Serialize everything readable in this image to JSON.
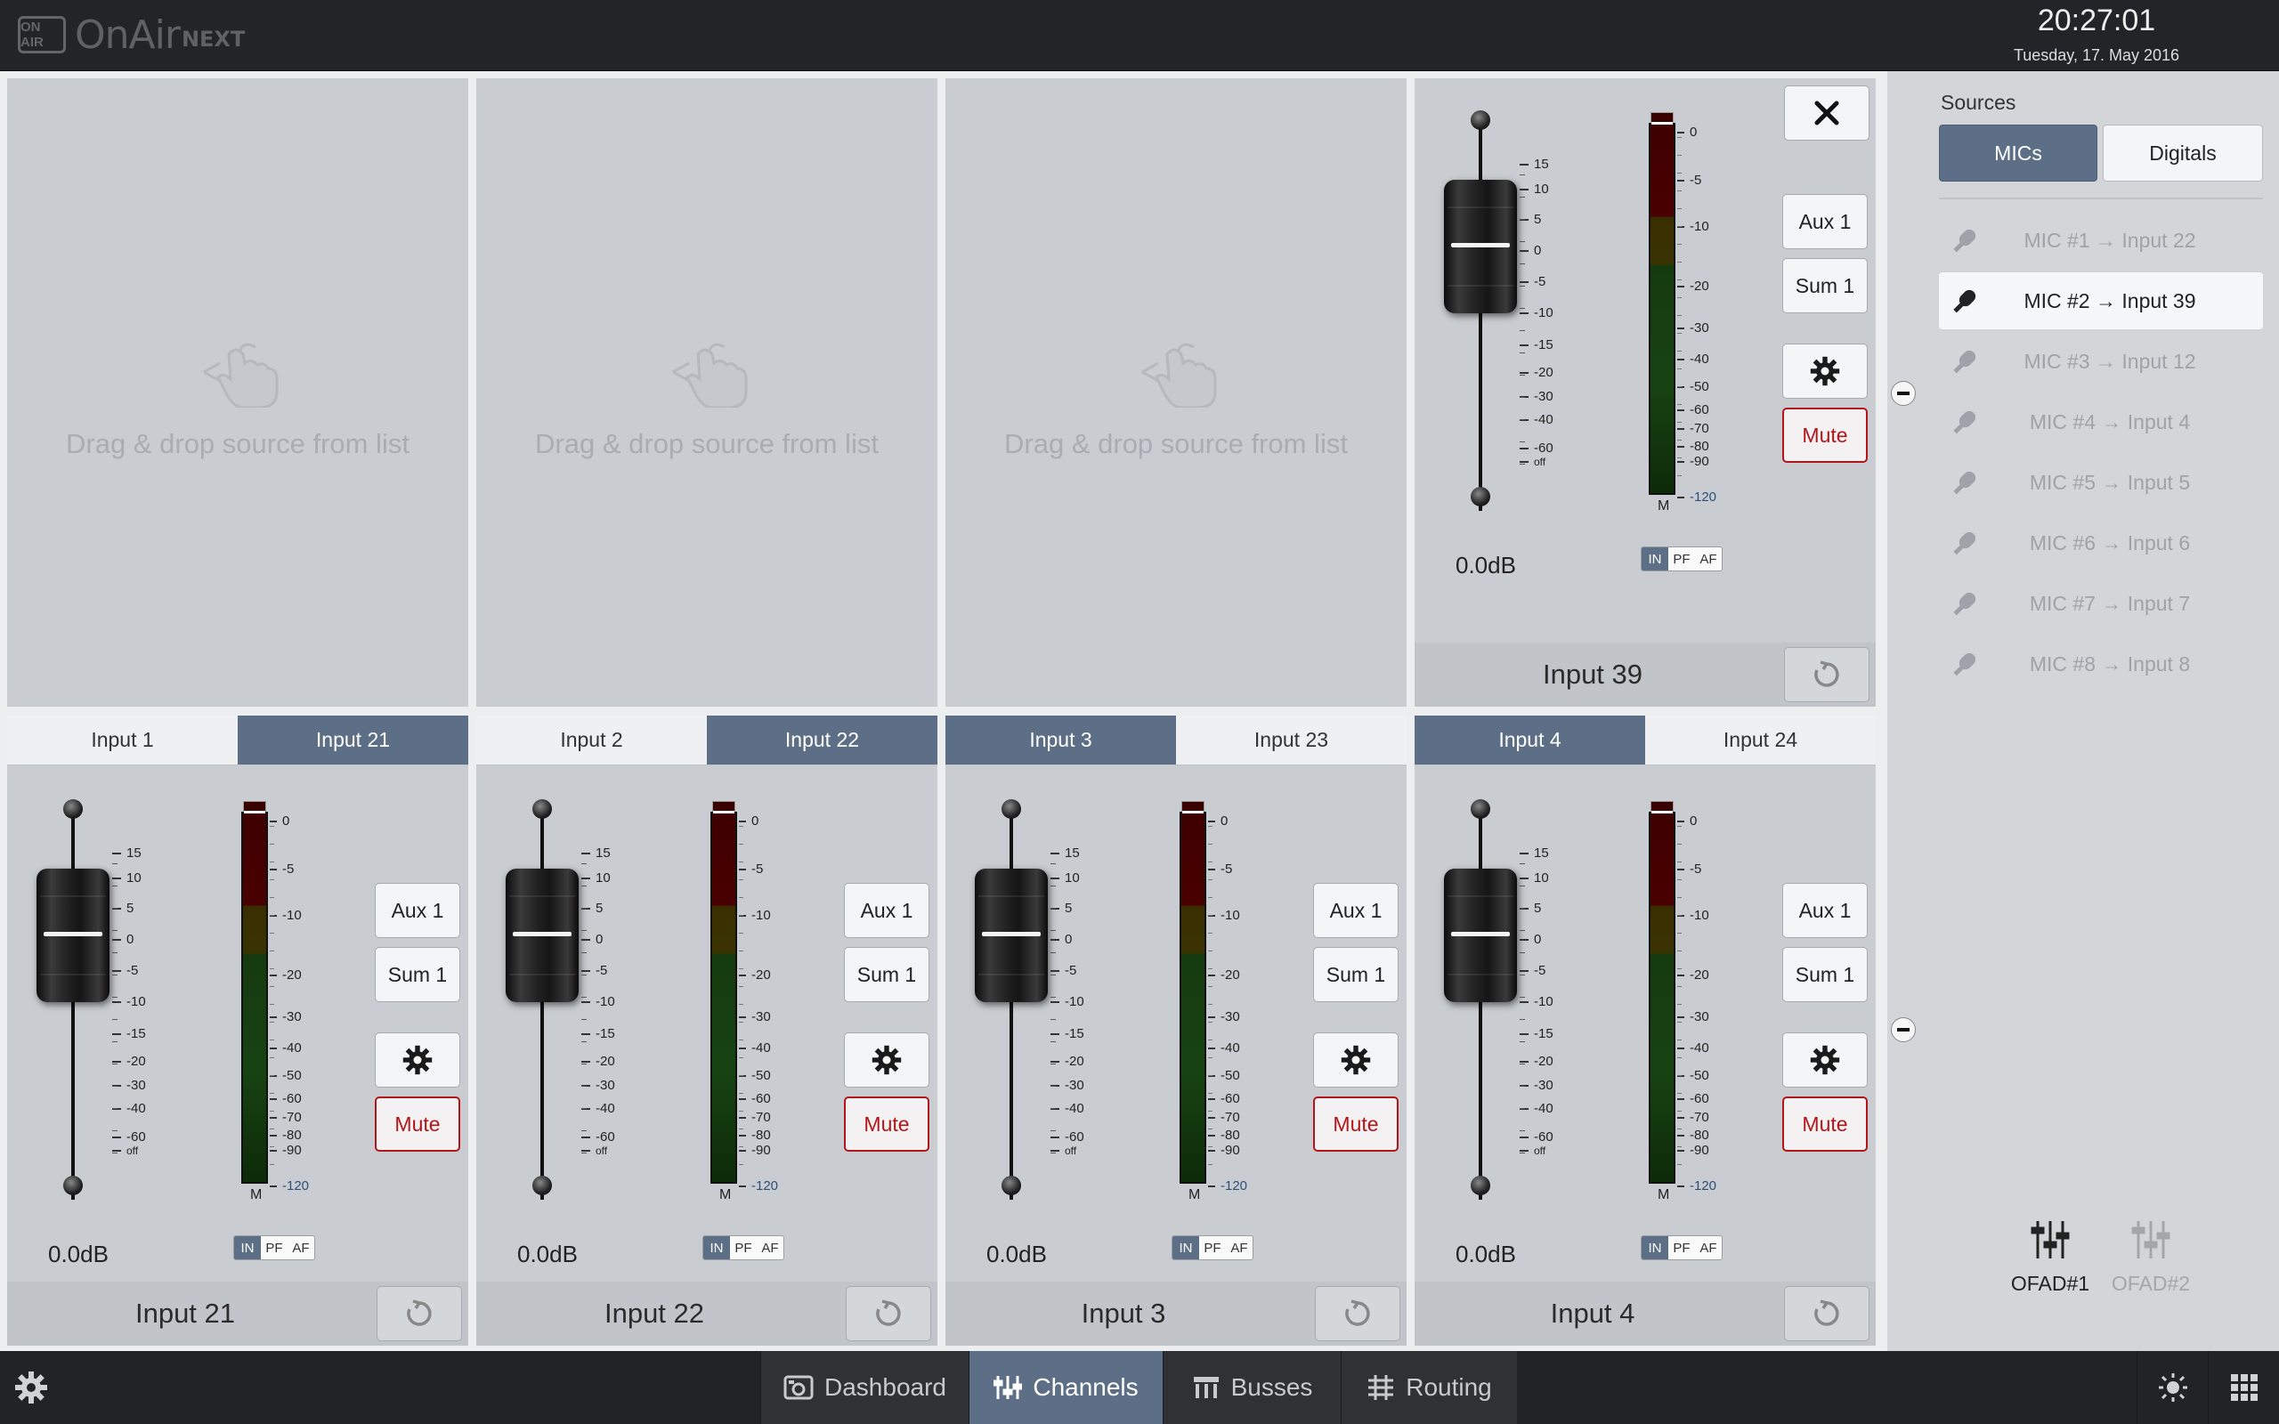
{
  "app": {
    "logo_badge": "ON AIR",
    "logo_name": "OnAir",
    "logo_suffix": "NEXT"
  },
  "clock": {
    "time": "20:27:01",
    "date": "Tuesday, 17. May 2016"
  },
  "colors": {
    "accent": "#5d6f86",
    "mute": "#b3161a",
    "topbar": "#232427"
  },
  "dropzones": [
    {
      "text": "Drag & drop source from list",
      "icon": "drag-hand-icon"
    },
    {
      "text": "Drag & drop source from list",
      "icon": "drag-hand-icon"
    },
    {
      "text": "Drag & drop source from list",
      "icon": "drag-hand-icon"
    }
  ],
  "fader_scale": [
    "15",
    "10",
    "5",
    "0",
    "-5",
    "-10",
    "-15",
    "-20",
    "-30",
    "-40",
    "-60",
    "off"
  ],
  "meter_scale": [
    "0",
    "-5",
    "-10",
    "-20",
    "-30",
    "-40",
    "-50",
    "-60",
    "-70",
    "-80",
    "-90",
    "-120"
  ],
  "top_channel": {
    "name": "Input 39",
    "gain": "0.0dB",
    "meter_label": "M",
    "aux": "Aux 1",
    "sum": "Sum 1",
    "mute": "Mute",
    "ipf": [
      "IN",
      "PF",
      "AF"
    ],
    "close_icon": "close-icon"
  },
  "channels": [
    {
      "tabs": [
        "Input 1",
        "Input 21"
      ],
      "active_tab": 1,
      "name": "Input 21",
      "gain": "0.0dB",
      "meter_label": "M",
      "aux": "Aux 1",
      "sum": "Sum 1",
      "mute": "Mute",
      "ipf": [
        "IN",
        "PF",
        "AF"
      ]
    },
    {
      "tabs": [
        "Input 2",
        "Input 22"
      ],
      "active_tab": 1,
      "name": "Input 22",
      "gain": "0.0dB",
      "meter_label": "M",
      "aux": "Aux 1",
      "sum": "Sum 1",
      "mute": "Mute",
      "ipf": [
        "IN",
        "PF",
        "AF"
      ]
    },
    {
      "tabs": [
        "Input 3",
        "Input 23"
      ],
      "active_tab": 0,
      "name": "Input 3",
      "gain": "0.0dB",
      "meter_label": "M",
      "aux": "Aux 1",
      "sum": "Sum 1",
      "mute": "Mute",
      "ipf": [
        "IN",
        "PF",
        "AF"
      ]
    },
    {
      "tabs": [
        "Input 4",
        "Input 24"
      ],
      "active_tab": 0,
      "name": "Input 4",
      "gain": "0.0dB",
      "meter_label": "M",
      "aux": "Aux 1",
      "sum": "Sum 1",
      "mute": "Mute",
      "ipf": [
        "IN",
        "PF",
        "AF"
      ]
    }
  ],
  "sources": {
    "title": "Sources",
    "tabs": [
      "MICs",
      "Digitals"
    ],
    "items": [
      {
        "label": "MIC #1 → Input 22",
        "selected": false
      },
      {
        "label": "MIC #2 → Input 39",
        "selected": true
      },
      {
        "label": "MIC #3 → Input 12",
        "selected": false
      },
      {
        "label": "MIC #4 → Input 4",
        "selected": false
      },
      {
        "label": "MIC #5 → Input 5",
        "selected": false
      },
      {
        "label": "MIC #6 → Input 6",
        "selected": false
      },
      {
        "label": "MIC #7 → Input 7",
        "selected": false
      },
      {
        "label": "MIC #8 → Input 8",
        "selected": false
      }
    ],
    "ofad": [
      "OFAD#1",
      "OFAD#2"
    ]
  },
  "bottom_nav": [
    {
      "label": "Dashboard",
      "icon": "dashboard-icon"
    },
    {
      "label": "Channels",
      "icon": "channels-icon"
    },
    {
      "label": "Busses",
      "icon": "busses-icon"
    },
    {
      "label": "Routing",
      "icon": "routing-icon"
    }
  ],
  "active_nav": "Channels"
}
